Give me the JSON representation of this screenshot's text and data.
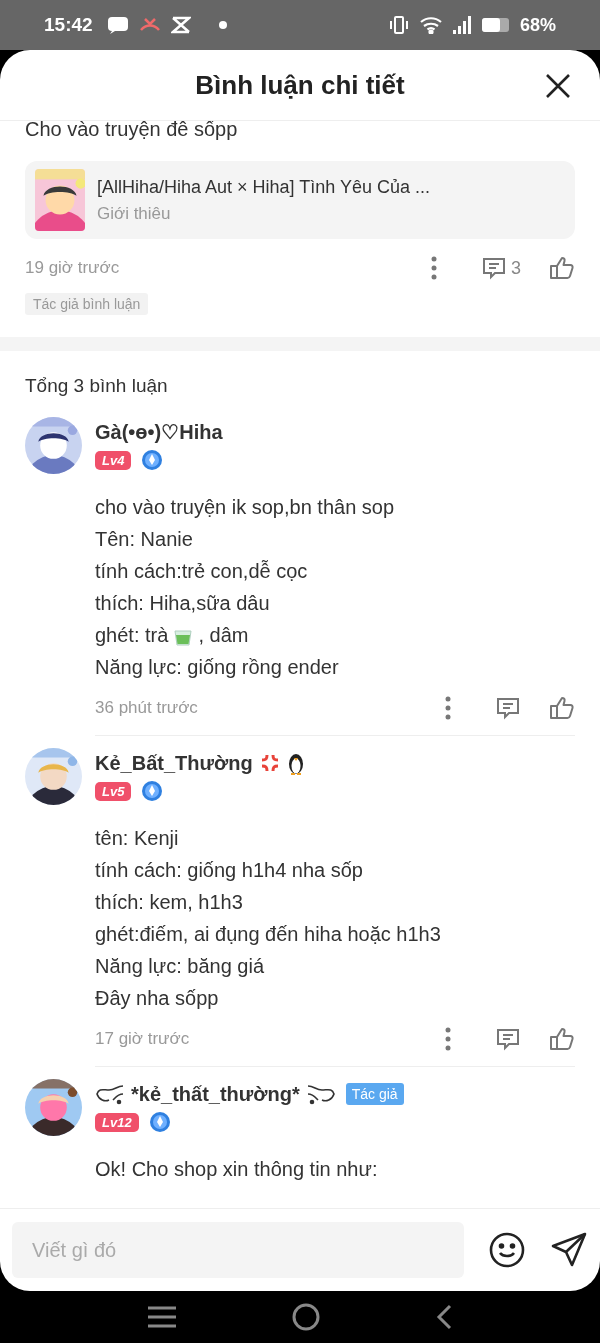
{
  "status_bar": {
    "time": "15:42",
    "battery": "68%"
  },
  "header": {
    "title": "Bình luận chi tiết"
  },
  "main_comment": {
    "text": "Cho vào truyện đê sốpp",
    "story": {
      "title": "[AllHiha/Hiha Aut × Hiha] Tình Yêu Của ...",
      "subtitle": "Giới thiêu"
    },
    "time": "19 giờ trước",
    "reply_count": "3",
    "tag": "Tác giả bình luận"
  },
  "replies_heading": "Tổng 3 bình luận",
  "comments": [
    {
      "name": "Gà(•ɵ•)♡Hiha",
      "kind": "plain",
      "level": "Lv4",
      "lines": [
        "cho vào truyện ik sop,bn thân sop",
        "Tên: Nanie",
        "tính cách:trẻ con,dễ cọc",
        "thích: Hiha,sữa dâu",
        {
          "before": "ghét: trà",
          "after": ", dâm"
        },
        "Năng lực: giống rồng ender"
      ],
      "time": "36 phút trước"
    },
    {
      "name": "Kẻ_Bất_Thường",
      "kind": "emoji",
      "level": "Lv5",
      "lines": [
        "tên: Kenji",
        "tính cách: giống h1h4 nha sốp",
        "thích: kem, h1h3",
        "ghét:điếm, ai đụng đến hiha hoặc h1h3",
        "Năng lực: băng giá",
        "Đây nha sốpp"
      ],
      "time": "17 giờ trước"
    },
    {
      "name": "*kẻ_thất_thường*",
      "kind": "ornate",
      "badge": "Tác giả",
      "level": "Lv12",
      "lines": [
        "Ok! Cho shop xin thông tin như:"
      ]
    }
  ],
  "composer": {
    "placeholder": "Viết gì đó"
  }
}
